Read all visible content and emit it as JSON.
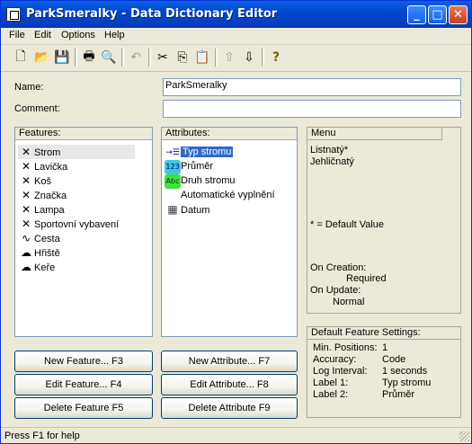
{
  "window": {
    "title": "ParkSmeralky - Data Dictionary Editor"
  },
  "menu": [
    "File",
    "Edit",
    "Options",
    "Help"
  ],
  "toolbar": {
    "icons": [
      "new-file-icon",
      "open-folder-icon",
      "save-icon",
      "print-icon",
      "print-preview-icon",
      "undo-icon",
      "cut-icon",
      "copy-icon",
      "paste-icon",
      "move-up-icon",
      "move-down-icon",
      "help-icon"
    ]
  },
  "form": {
    "name_label": "Name:",
    "name_value": "ParkSmeralky",
    "comment_label": "Comment:",
    "comment_value": ""
  },
  "features": {
    "header": "Features:",
    "items": [
      {
        "label": "Strom",
        "type": "point"
      },
      {
        "label": "Lavička",
        "type": "point"
      },
      {
        "label": "Koš",
        "type": "point"
      },
      {
        "label": "Značka",
        "type": "point"
      },
      {
        "label": "Lampa",
        "type": "point"
      },
      {
        "label": "Sportovní vybavení",
        "type": "point"
      },
      {
        "label": "Cesta",
        "type": "line"
      },
      {
        "label": "Hřiště",
        "type": "area"
      },
      {
        "label": "Keře",
        "type": "area"
      }
    ],
    "selected": 0
  },
  "attributes": {
    "header": "Attributes:",
    "items": [
      {
        "label": "Typ stromu",
        "icon": "→☰"
      },
      {
        "label": "Průměr",
        "icon": "123"
      },
      {
        "label": "Druh stromu",
        "icon": "Abc"
      },
      {
        "label": "Automatické vyplnění",
        "icon": ""
      },
      {
        "label": "Datum",
        "icon": "▦"
      }
    ],
    "selected": 0
  },
  "menu_panel": {
    "header": "Menu",
    "values": [
      "Listnatý*",
      "Jehličnatý"
    ],
    "default_note": "* = Default Value",
    "on_creation_label": "On Creation:",
    "on_creation_value": "Required",
    "on_update_label": "On Update:",
    "on_update_value": "Normal"
  },
  "default_settings": {
    "header": "Default Feature Settings:",
    "rows": [
      {
        "label": "Min. Positions:",
        "value": "1"
      },
      {
        "label": "Accuracy:",
        "value": "Code"
      },
      {
        "label": "Log Interval:",
        "value": "1 seconds"
      },
      {
        "label": "Label 1:",
        "value": "Typ stromu"
      },
      {
        "label": "Label 2:",
        "value": "Průměr"
      }
    ]
  },
  "buttons": {
    "new_feature": "New Feature... F3",
    "edit_feature": "Edit Feature... F4",
    "delete_feature": "Delete Feature F5",
    "new_attribute": "New Attribute... F7",
    "edit_attribute": "Edit Attribute... F8",
    "delete_attribute": "Delete Attribute F9"
  },
  "status": {
    "text": "Press F1 for help"
  }
}
